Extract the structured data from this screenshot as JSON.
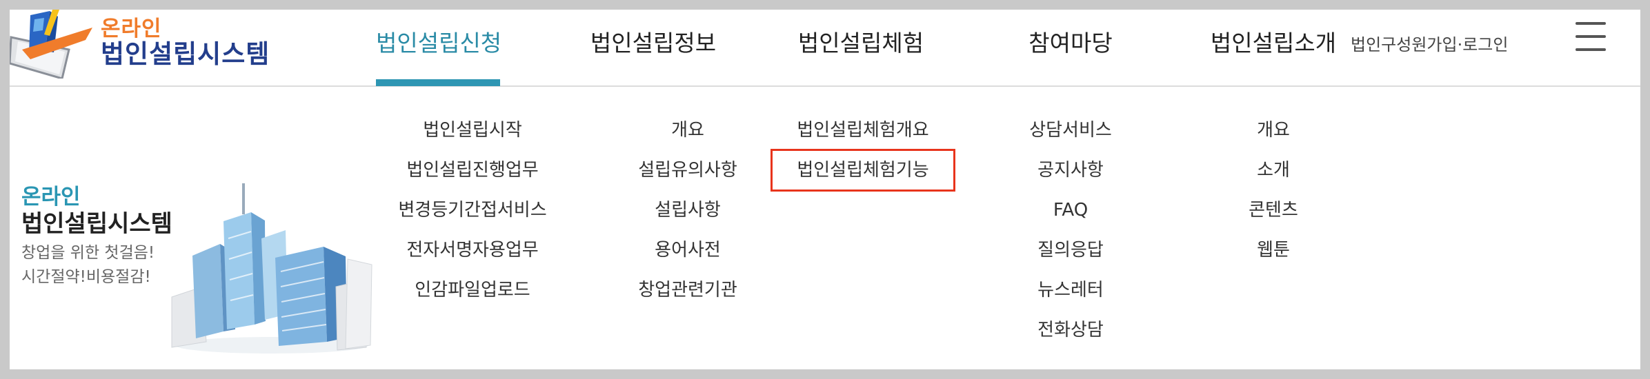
{
  "logo": {
    "small": "온라인",
    "big": "법인설립시스템"
  },
  "nav": [
    {
      "label": "법인설립신청",
      "active": true
    },
    {
      "label": "법인설립정보",
      "active": false
    },
    {
      "label": "법인설립체험",
      "active": false
    },
    {
      "label": "참여마당",
      "active": false
    },
    {
      "label": "법인설립소개",
      "active": false
    }
  ],
  "auth": {
    "join": "법인구성원가입",
    "separator": "·",
    "login": "로그인"
  },
  "icons": {
    "menu": "hamburger-menu-icon"
  },
  "colors": {
    "accent": "#2e96b3",
    "logo_orange": "#f07c2b",
    "logo_navy": "#233e8c",
    "highlight_box": "#e8341c"
  },
  "promo": {
    "line1": "온라인",
    "line2": "법인설립시스템",
    "line3": "창업을 위한 첫걸음!",
    "line4": "시간절약!비용절감!"
  },
  "menu": {
    "columns": [
      {
        "items": [
          "법인설립시작",
          "법인설립진행업무",
          "변경등기간접서비스",
          "전자서명자용업무",
          "인감파일업로드"
        ]
      },
      {
        "items": [
          "개요",
          "설립유의사항",
          "설립사항",
          "용어사전",
          "창업관련기관"
        ]
      },
      {
        "items": [
          "법인설립체험개요",
          "법인설립체험기능"
        ]
      },
      {
        "items": [
          "상담서비스",
          "공지사항",
          "FAQ",
          "질의응답",
          "뉴스레터",
          "전화상담"
        ]
      },
      {
        "items": [
          "개요",
          "소개",
          "콘텐츠",
          "웹툰"
        ]
      }
    ],
    "highlighted_item": "법인설립체험기능"
  }
}
